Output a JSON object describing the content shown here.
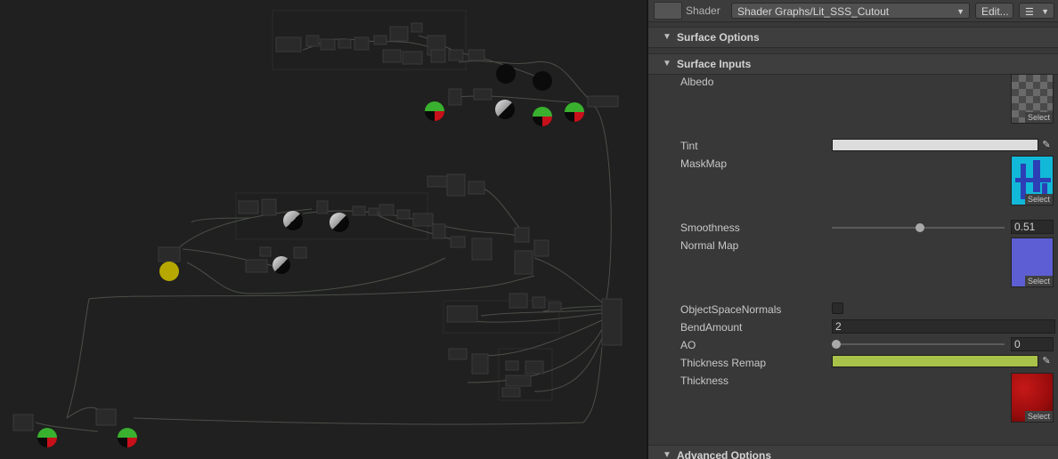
{
  "graph": {
    "preview_colors": {
      "green": "#39b02e",
      "red": "#c8101a",
      "yellow": "#b6a800",
      "black": "#0a0a0a"
    }
  },
  "inspector": {
    "shader_label": "Shader",
    "shader_value": "Shader Graphs/Lit_SSS_Cutout",
    "edit_label": "Edit...",
    "list_icon": "list-icon",
    "sections": {
      "surface_options": "Surface Options",
      "surface_inputs": "Surface Inputs",
      "advanced_options": "Advanced Options"
    },
    "props": {
      "albedo": "Albedo",
      "tint": "Tint",
      "mask_map": "MaskMap",
      "smoothness": "Smoothness",
      "smoothness_value": "0.51",
      "smoothness_fraction": 0.51,
      "normal_map": "Normal Map",
      "object_space_normals": "ObjectSpaceNormals",
      "object_space_normals_checked": false,
      "bend_amount": "BendAmount",
      "bend_amount_value": "2",
      "ao": "AO",
      "ao_value": "0",
      "ao_fraction": 0,
      "thickness_remap": "Thickness Remap",
      "thickness": "Thickness",
      "select_label": "Select"
    },
    "colors": {
      "tint": "#dcdcdc",
      "thickness_remap": "#a9c24a",
      "normal_map": "#5e5ed4",
      "mask_map": "#12b8d8",
      "thickness": "#9a0c0c"
    }
  }
}
